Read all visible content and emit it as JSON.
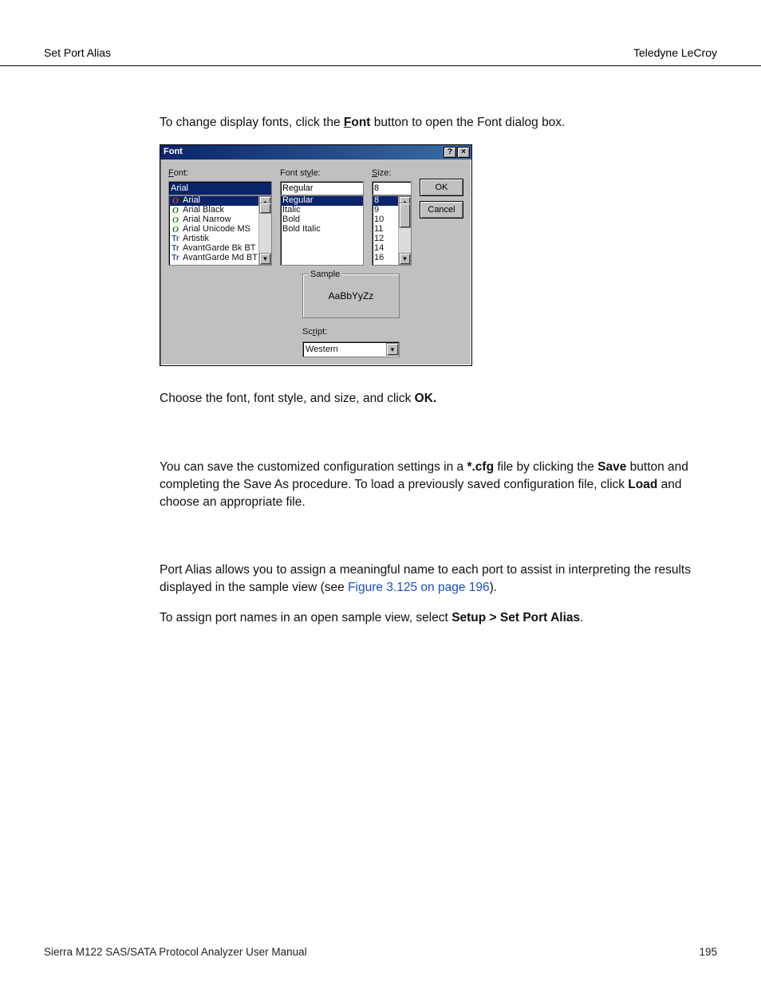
{
  "header": {
    "left": "Set Port Alias",
    "right": "Teledyne LeCroy"
  },
  "body": {
    "intro_before": "To change display fonts, click the ",
    "intro_font_word": "Font",
    "intro_after": " button to open the Font dialog box.",
    "after_dialog": "Choose the font, font style, and size, and click ",
    "ok_word": "OK.",
    "save_para_a": "You can save the customized configuration settings in a ",
    "cfg_word": "*.cfg",
    "save_para_b": " file by clicking the ",
    "save_word": "Save",
    "save_para_c": " button and completing the Save As procedure. To load a previously saved configuration file, click ",
    "load_word": "Load",
    "save_para_d": " and choose an appropriate file.",
    "alias_para_a": "Port Alias allows you to assign a meaningful name to each port to assist in interpreting the results displayed in the sample view (see ",
    "alias_link": "Figure 3.125 on page 196",
    "alias_para_b": ").",
    "assign_para_a": "To assign port names in an open sample view, select ",
    "menu_path": "Setup > Set Port Alias",
    "assign_para_b": "."
  },
  "dialog": {
    "title": "Font",
    "help_glyph": "?",
    "close_glyph": "×",
    "labels": {
      "font": "Font:",
      "style": "Font style:",
      "size": "Size:",
      "sample": "Sample",
      "script": "Script:"
    },
    "inputs": {
      "font_value": "Arial",
      "style_value": "Regular",
      "size_value": "8",
      "script_value": "Western"
    },
    "font_list": [
      "Arial",
      "Arial Black",
      "Arial Narrow",
      "Arial Unicode MS",
      "Artistik",
      "AvantGarde Bk BT",
      "AvantGarde Md BT"
    ],
    "style_list": [
      "Regular",
      "Italic",
      "Bold",
      "Bold Italic"
    ],
    "size_list": [
      "8",
      "9",
      "10",
      "11",
      "12",
      "14",
      "16"
    ],
    "sample_text": "AaBbYyZz",
    "buttons": {
      "ok": "OK",
      "cancel": "Cancel"
    }
  },
  "footer": {
    "manual": "Sierra M122 SAS/SATA Protocol Analyzer User Manual",
    "page": "195"
  }
}
